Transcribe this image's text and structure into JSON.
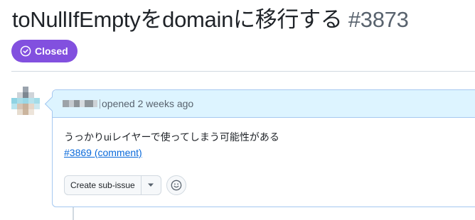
{
  "issue": {
    "title": "toNullIfEmptyをdomainに移行する",
    "number": "#3873",
    "state_label": "Closed",
    "state_color": "#8250df"
  },
  "comment": {
    "author": "",
    "action_text": "opened 2 weeks ago",
    "body_text": "うっかりuiレイヤーで使ってしまう可能性がある",
    "link_text": "#3869 (comment)"
  },
  "actions": {
    "create_sub_issue_label": "Create sub-issue",
    "caret_icon": "triangle-down-icon",
    "reaction_icon": "smiley-icon"
  },
  "colors": {
    "closed_purple": "#8250df",
    "link_blue": "#0969da",
    "header_blue": "#ddf4ff"
  }
}
